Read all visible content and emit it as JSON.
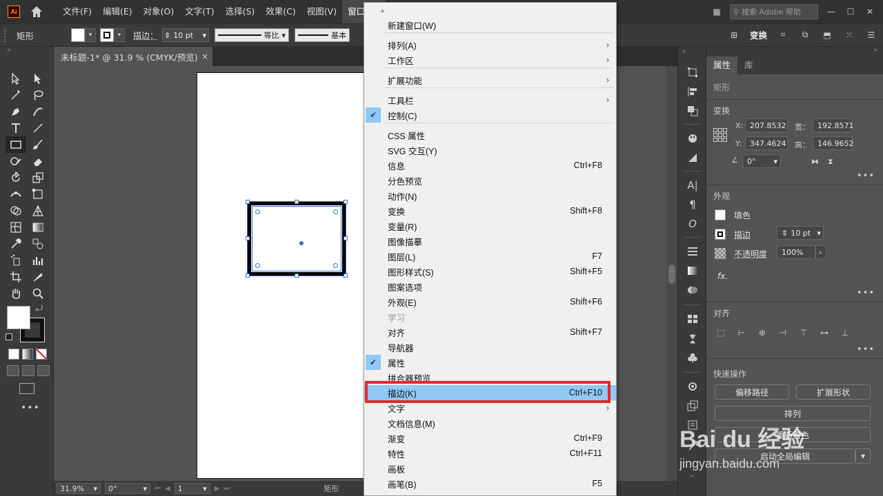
{
  "menubar": {
    "logo": "Ai",
    "items": [
      "文件(F)",
      "编辑(E)",
      "对象(O)",
      "文字(T)",
      "选择(S)",
      "效果(C)",
      "视图(V)",
      "窗口(W)"
    ],
    "search_placeholder": "搜索 Adobe 帮助"
  },
  "controlbar": {
    "shape": "矩形",
    "stroke_label": "描边：",
    "stroke_value": "10 pt",
    "profile_label": "等比",
    "brush_label": "基本",
    "transform": "变换"
  },
  "tab": {
    "title": "未标题-1* @ 31.9 % (CMYK/预览)",
    "close": "×"
  },
  "statusbar": {
    "zoom": "31.9%",
    "rotation": "0°",
    "artboard": "1",
    "tool": "矩形"
  },
  "properties": {
    "tabs": [
      "属性",
      "库"
    ],
    "selection": "矩形",
    "transform_title": "变换",
    "x_label": "X:",
    "x_value": "207.8532",
    "y_label": "Y:",
    "y_value": "347.4624",
    "w_label": "宽：",
    "w_value": "192.8571",
    "h_label": "高：",
    "h_value": "146.9652",
    "angle_value": "0°",
    "appearance_title": "外观",
    "fill_label": "填色",
    "stroke_label": "描边",
    "stroke_value": "10 pt",
    "opacity_label": "不透明度",
    "opacity_value": "100%",
    "fx_label": "fx.",
    "align_title": "对齐",
    "quick_title": "快速操作",
    "btn_offset": "偏移路径",
    "btn_expand": "扩展形状",
    "btn_arrange": "排列",
    "btn_recolor": "重新着色",
    "btn_global": "启动全局编辑"
  },
  "window_menu": {
    "items": [
      {
        "label": "新建窗口(W)"
      },
      {
        "label": "排列(A)",
        "sub": true
      },
      {
        "label": "工作区",
        "sub": true
      },
      {
        "label": "扩展功能",
        "sub": true
      },
      {
        "label": "工具栏",
        "sub": true
      },
      {
        "label": "控制(C)",
        "checked": true
      },
      {
        "label": "CSS 属性"
      },
      {
        "label": "SVG 交互(Y)"
      },
      {
        "label": "信息",
        "shortcut": "Ctrl+F8"
      },
      {
        "label": "分色预览"
      },
      {
        "label": "动作(N)"
      },
      {
        "label": "变换",
        "shortcut": "Shift+F8"
      },
      {
        "label": "变量(R)"
      },
      {
        "label": "图像描摹"
      },
      {
        "label": "图层(L)",
        "shortcut": "F7"
      },
      {
        "label": "图形样式(S)",
        "shortcut": "Shift+F5"
      },
      {
        "label": "图案选项"
      },
      {
        "label": "外观(E)",
        "shortcut": "Shift+F6"
      },
      {
        "label": "学习",
        "disabled": true
      },
      {
        "label": "对齐",
        "shortcut": "Shift+F7"
      },
      {
        "label": "导航器"
      },
      {
        "label": "属性",
        "checked": true
      },
      {
        "label": "拼合器预览"
      },
      {
        "label": "描边(K)",
        "shortcut": "Ctrl+F10",
        "highlighted": true
      },
      {
        "label": "文字",
        "sub": true
      },
      {
        "label": "文档信息(M)"
      },
      {
        "label": "渐变",
        "shortcut": "Ctrl+F9"
      },
      {
        "label": "特性",
        "shortcut": "Ctrl+F11"
      },
      {
        "label": "画板"
      },
      {
        "label": "画笔(B)",
        "shortcut": "F5"
      }
    ]
  },
  "watermark": {
    "text": "Bai du 经验",
    "url": "jingyan.baidu.com"
  },
  "colors": {
    "menu_highlight": "#90c8f6",
    "annotation_red": "#e8262c",
    "selection_blue": "#3b6fd6"
  }
}
